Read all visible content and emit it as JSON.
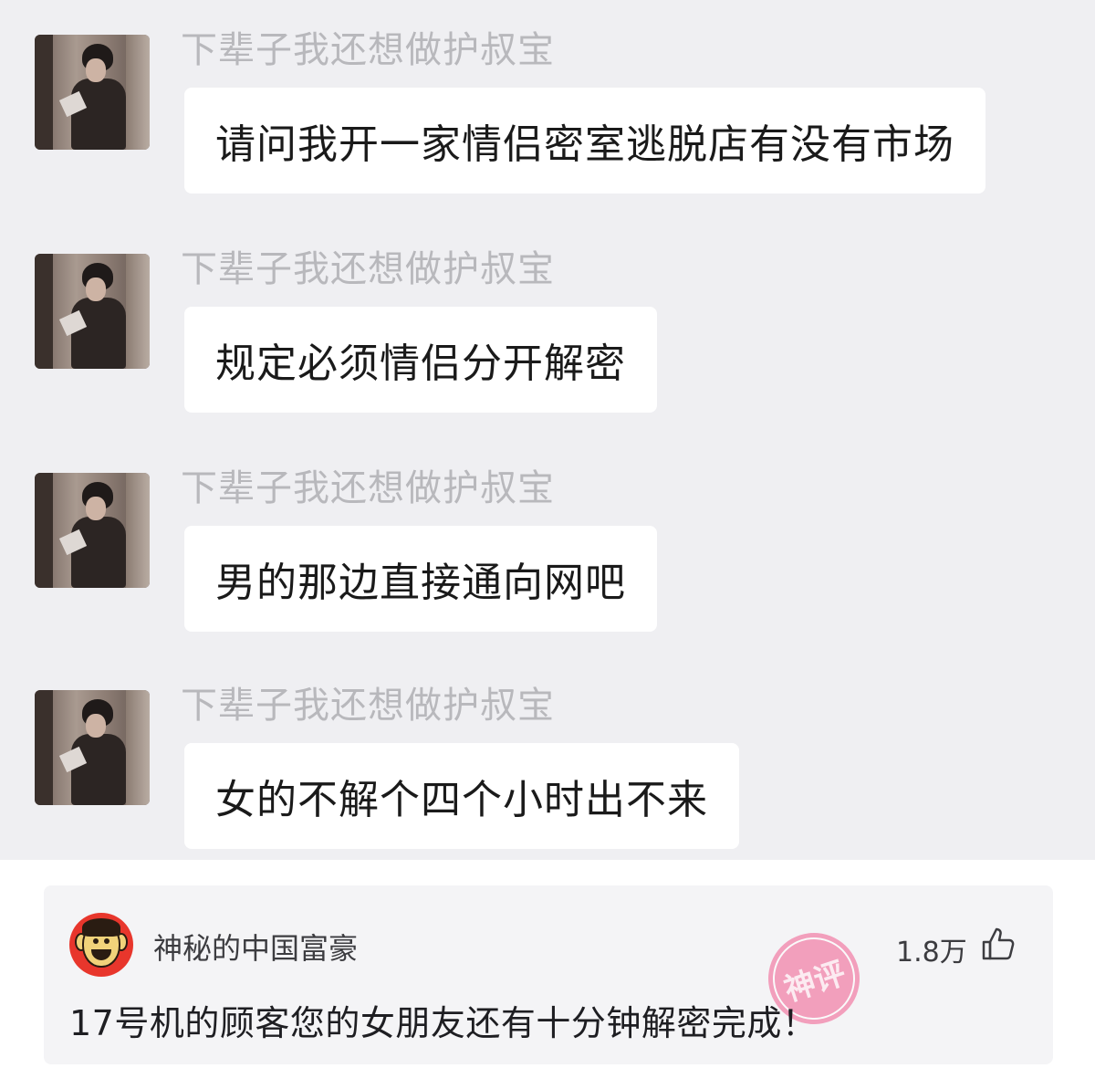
{
  "chat": {
    "messages": [
      {
        "nickname": "下辈子我还想做护叔宝",
        "text": "请问我开一家情侣密室逃脱店有没有市场"
      },
      {
        "nickname": "下辈子我还想做护叔宝",
        "text": "规定必须情侣分开解密"
      },
      {
        "nickname": "下辈子我还想做护叔宝",
        "text": "男的那边直接通向网吧"
      },
      {
        "nickname": "下辈子我还想做护叔宝",
        "text": "女的不解个四个小时出不来"
      }
    ]
  },
  "comment": {
    "username": "神秘的中国富豪",
    "likes": "1.8万",
    "text": "17号机的顾客您的女朋友还有十分钟解密完成！",
    "stamp_text": "神评",
    "stamp_color": "#f25a8e",
    "avatar_color": "#e8362c"
  }
}
